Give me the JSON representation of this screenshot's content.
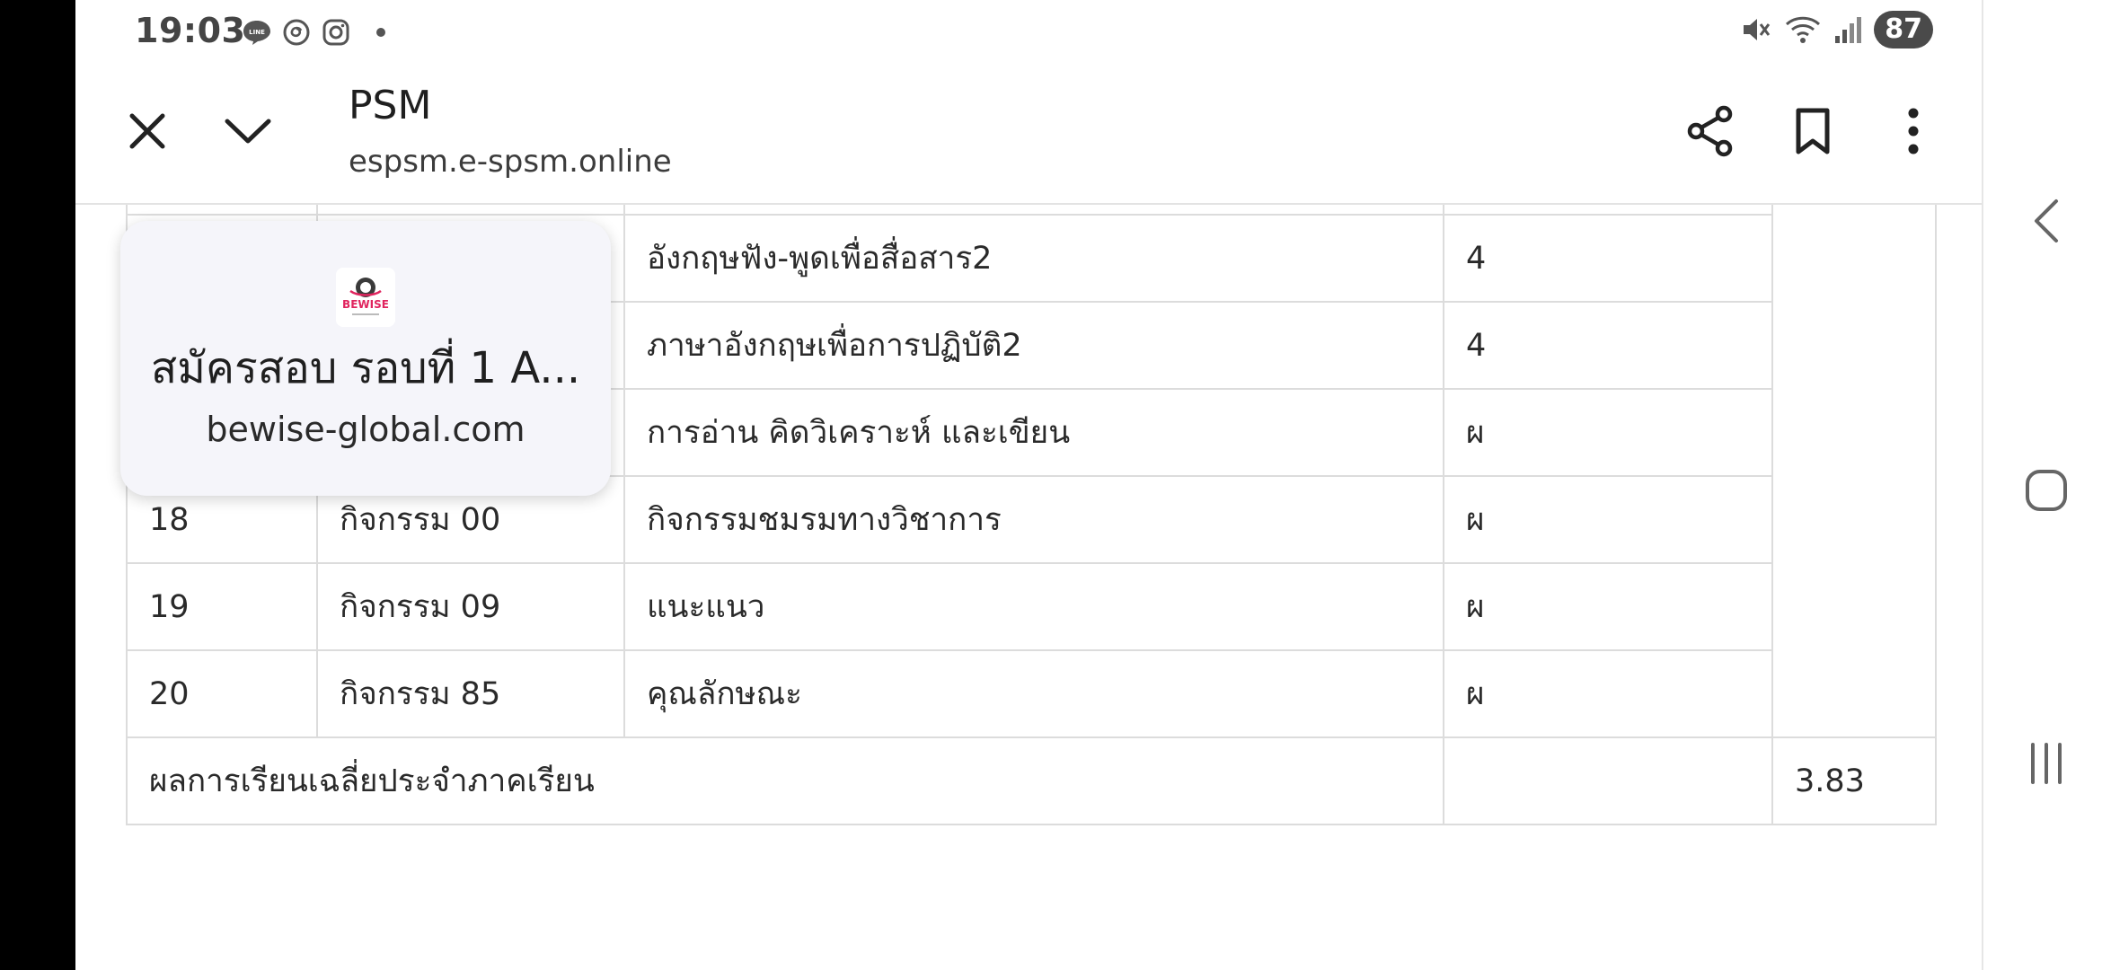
{
  "status_bar": {
    "time": "19:03",
    "notification_icons": [
      "line-icon",
      "threads-icon",
      "instagram-icon",
      "dot-icon"
    ],
    "system_icons": [
      "mute-icon",
      "wifi-icon",
      "signal-icon"
    ],
    "battery": "87"
  },
  "toolbar": {
    "title": "PSM",
    "url": "espsm.e-spsm.online",
    "actions": [
      "close-icon",
      "chevron-down-icon",
      "share-icon",
      "bookmark-icon",
      "more-vert-icon"
    ]
  },
  "popup": {
    "title": "สมัครสอบ รอบที่ 1 A...",
    "domain": "bewise-global.com",
    "logo_text": "BEWISE"
  },
  "table": {
    "rows": [
      {
        "no": "",
        "code": "",
        "name": "อังกฤษฟัง-พูดเพื่อสื่อสาร2",
        "grade": "4"
      },
      {
        "no": "",
        "code": "",
        "name": "ภาษาอังกฤษเพื่อการปฏิบัติ2",
        "grade": "4"
      },
      {
        "no": "",
        "code": "",
        "name": "การอ่าน คิดวิเคราะห์ และเขียน",
        "grade": "ผ"
      },
      {
        "no": "18",
        "code": "กิจกรรม 00",
        "name": "กิจกรรมชมรมทางวิชาการ",
        "grade": "ผ"
      },
      {
        "no": "19",
        "code": "กิจกรรม 09",
        "name": "แนะแนว",
        "grade": "ผ"
      },
      {
        "no": "20",
        "code": "กิจกรรม 85",
        "name": "คุณลักษณะ",
        "grade": "ผ"
      }
    ],
    "summary_label": "ผลการเรียนเฉลี่ยประจำภาคเรียน",
    "gpa": "3.83"
  },
  "nav": [
    "back-icon",
    "home-icon",
    "recents-icon"
  ],
  "colors": {
    "battery_bg": "#4a4a4a",
    "border": "#dcdcdc",
    "popup_bg": "#f5f5fa",
    "logo_accent": "#e0245e"
  }
}
